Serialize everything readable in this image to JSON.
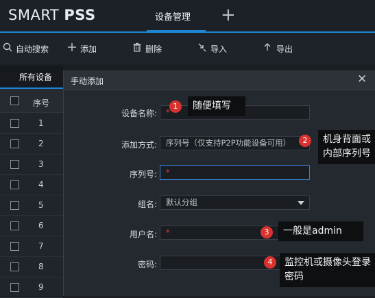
{
  "app": {
    "logo_light": "SMART ",
    "logo_bold": "PSS"
  },
  "tabs": {
    "active": "设备管理",
    "add": "+"
  },
  "toolbar": {
    "auto_search": "自动搜索",
    "add": "添加",
    "delete": "删除",
    "import": "导入",
    "export": "导出"
  },
  "sidebar": {
    "tab": "所有设备",
    "col_index": "序号",
    "rows": [
      "1",
      "2",
      "3",
      "4",
      "5",
      "6",
      "7",
      "8",
      "9"
    ]
  },
  "dialog": {
    "title": "手动添加",
    "close": "✕",
    "name_label": "设备名称:",
    "name_value": "*",
    "method_label": "添加方式:",
    "method_value": "序列号（仅支持P2P功能设备可用）",
    "serial_label": "序列号:",
    "serial_value": "*",
    "group_label": "组名:",
    "group_value": "默认分组",
    "user_label": "用户名:",
    "user_value": "*",
    "pwd_label": "密码:"
  },
  "annotations": [
    {
      "num": "1",
      "text": "随便填写"
    },
    {
      "num": "2",
      "text": "机身背面或内部序列号"
    },
    {
      "num": "3",
      "text": "一般是admin"
    },
    {
      "num": "4",
      "text": "监控机或摄像头登录密码"
    }
  ],
  "colors": {
    "accent": "#1f86d6",
    "marker": "#d9322f"
  }
}
